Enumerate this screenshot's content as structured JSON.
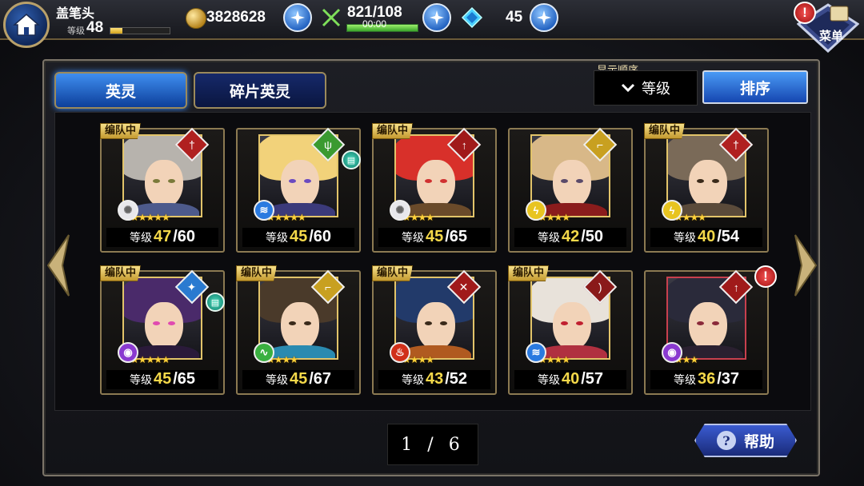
{
  "header": {
    "player_name": "盖笔头",
    "level_label": "等级",
    "level": "48",
    "exp_fraction": 0.2,
    "gold": "3828628",
    "stamina": "821/108",
    "stamina_timer": "00:00",
    "stamina_fraction": 1.0,
    "crystals": "45",
    "menu_label": "菜单"
  },
  "tabs": [
    {
      "label": "英灵",
      "active": true
    },
    {
      "label": "碎片英灵",
      "active": false
    }
  ],
  "sort": {
    "caption": "显示顺序",
    "current": "等级",
    "button_label": "排序"
  },
  "level_prefix": "等级",
  "team_badge_label": "编队中",
  "heroes": [
    {
      "in_team": true,
      "level": "47",
      "max_level": "/60",
      "stars": "★★★★★",
      "element": "light",
      "class": "sword",
      "hair": "#b7b3ad",
      "body": "#4d5a8c",
      "eye": "#7a7a3a"
    },
    {
      "in_team": false,
      "level": "45",
      "max_level": "/60",
      "stars": "★★★★★",
      "element": "water",
      "class": "staff",
      "hair": "#f2d27a",
      "body": "#3b3a7a",
      "eye": "#6a4ac0",
      "book": true
    },
    {
      "in_team": true,
      "level": "45",
      "max_level": "/65",
      "stars": "★★★★",
      "element": "light",
      "class": "spear",
      "hair": "#d8302a",
      "body": "#6a4a2a",
      "eye": "#d03030"
    },
    {
      "in_team": false,
      "level": "42",
      "max_level": "/50",
      "stars": "★★★★",
      "element": "thunder",
      "class": "gun",
      "hair": "#d8b888",
      "body": "#8a1c1c",
      "eye": "#5a4a6a"
    },
    {
      "in_team": true,
      "level": "40",
      "max_level": "/54",
      "stars": "★★★★",
      "element": "thunder",
      "class": "sword",
      "hair": "#7a6a58",
      "body": "#5a4a3a",
      "eye": "#3a2a1a"
    },
    {
      "in_team": true,
      "level": "45",
      "max_level": "/65",
      "stars": "★★★★★",
      "element": "dark",
      "class": "wand",
      "hair": "#4a2a6a",
      "body": "#2a1a3a",
      "eye": "#e04ab0",
      "book": true
    },
    {
      "in_team": true,
      "level": "45",
      "max_level": "/67",
      "stars": "★★★★",
      "element": "wind",
      "class": "gun",
      "hair": "#4a3a2a",
      "body": "#2a8ab0",
      "eye": "#3a2a1a"
    },
    {
      "in_team": true,
      "level": "43",
      "max_level": "/52",
      "stars": "★★★★",
      "element": "fire",
      "class": "dagger",
      "hair": "#223a6a",
      "body": "#b05a20",
      "eye": "#3a2a1a"
    },
    {
      "in_team": true,
      "level": "40",
      "max_level": "/57",
      "stars": "★★★★",
      "element": "water",
      "class": "bow",
      "hair": "#e8e2da",
      "body": "#b03040",
      "eye": "#c02030"
    },
    {
      "in_team": false,
      "level": "36",
      "max_level": "/37",
      "stars": "★★★",
      "element": "dark",
      "class": "spear",
      "hair": "#2a2a3a",
      "body": "#2a2030",
      "eye": "#8a2a3a",
      "alert": true,
      "rarity": "red"
    }
  ],
  "pager": {
    "text": "1 / 6"
  },
  "help": {
    "label": "帮助"
  },
  "colors": {
    "accent_blue": "#1f5fbf",
    "level_yellow": "#f5d94a",
    "gold_border": "#8c7a52"
  }
}
